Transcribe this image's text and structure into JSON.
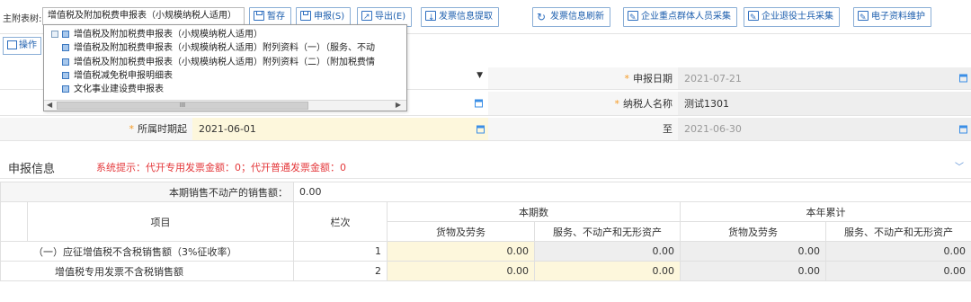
{
  "toolbar": {
    "attach_label": "主附表树:",
    "selected_form": "增值税及附加税费申报表（小规模纳税人适用）",
    "buttons": [
      {
        "label": "暂存"
      },
      {
        "label": "申报(S)"
      },
      {
        "label": "导出(E)"
      },
      {
        "label": "发票信息提取"
      },
      {
        "label": "发票信息刷新"
      },
      {
        "label": "企业重点群体人员采集"
      },
      {
        "label": "企业退役士兵采集"
      },
      {
        "label": "电子资料维护"
      }
    ],
    "operate_label": "操作"
  },
  "form_dropdown": {
    "items": [
      {
        "label": "增值税及附加税费申报表（小规模纳税人适用）"
      },
      {
        "label": "增值税及附加税费申报表（小规模纳税人适用）附列资料（一）（服务、不动"
      },
      {
        "label": "增值税及附加税费申报表（小规模纳税人适用）附列资料（二）（附加税费情"
      },
      {
        "label": "增值税减免税申报明细表"
      },
      {
        "label": "文化事业建设费申报表"
      }
    ],
    "scroll_marker": "III"
  },
  "form": {
    "declare_date_label": "申报日期",
    "declare_date": "2021-07-21",
    "taxpayer_name_label": "纳税人名称",
    "taxpayer_name": "测试1301",
    "period_start_label": "所属时期起",
    "period_start": "2021-06-01",
    "period_end_label": "至",
    "period_end": "2021-06-30"
  },
  "section": {
    "title": "申报信息",
    "hint": "系统提示：代开专用发票金额：0；代开普通发票金额：0"
  },
  "table": {
    "realestate_label": "本期销售不动产的销售额：",
    "realestate_value": "0.00",
    "col_item": "项目",
    "col_line": "栏次",
    "col_current": "本期数",
    "col_ytd": "本年累计",
    "col_goods": "货物及劳务",
    "col_services": "服务、不动产和无形资产",
    "rows": [
      {
        "item": "（一）应征增值税不含税销售额（3%征收率）",
        "line": "1",
        "v1": "0.00",
        "v2": "0.00",
        "v3": "0.00",
        "v4": "0.00"
      },
      {
        "item": "增值税专用发票不含税销售额",
        "line": "2",
        "v1": "0.00",
        "v2": "0.00",
        "v3": "0.00",
        "v4": "0.00"
      }
    ]
  },
  "colors": {
    "accent": "#1e5fae",
    "required": "#f59a23",
    "hint": "#e4393c",
    "editable_bg": "#fdf7dc",
    "readonly_bg": "#eeeeee"
  }
}
